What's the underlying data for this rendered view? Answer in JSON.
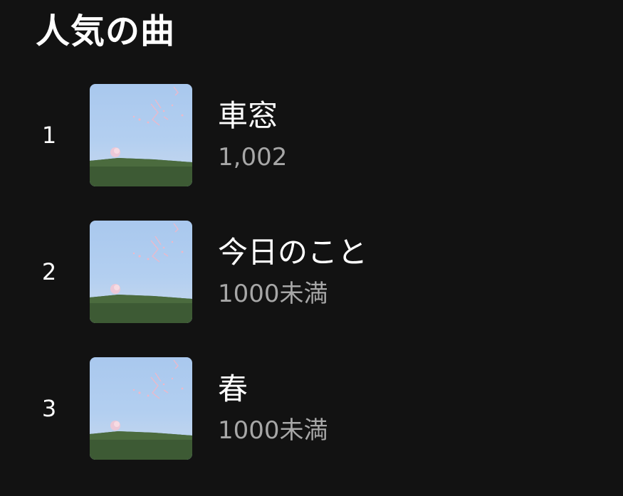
{
  "section": {
    "title": "人気の曲"
  },
  "tracks": [
    {
      "rank": "1",
      "title": "車窓",
      "plays": "1,002"
    },
    {
      "rank": "2",
      "title": "今日のこと",
      "plays": "1000未満"
    },
    {
      "rank": "3",
      "title": "春",
      "plays": "1000未満"
    }
  ],
  "colors": {
    "background": "#121212",
    "primary_text": "#ffffff",
    "secondary_text": "#a7a7a7"
  }
}
